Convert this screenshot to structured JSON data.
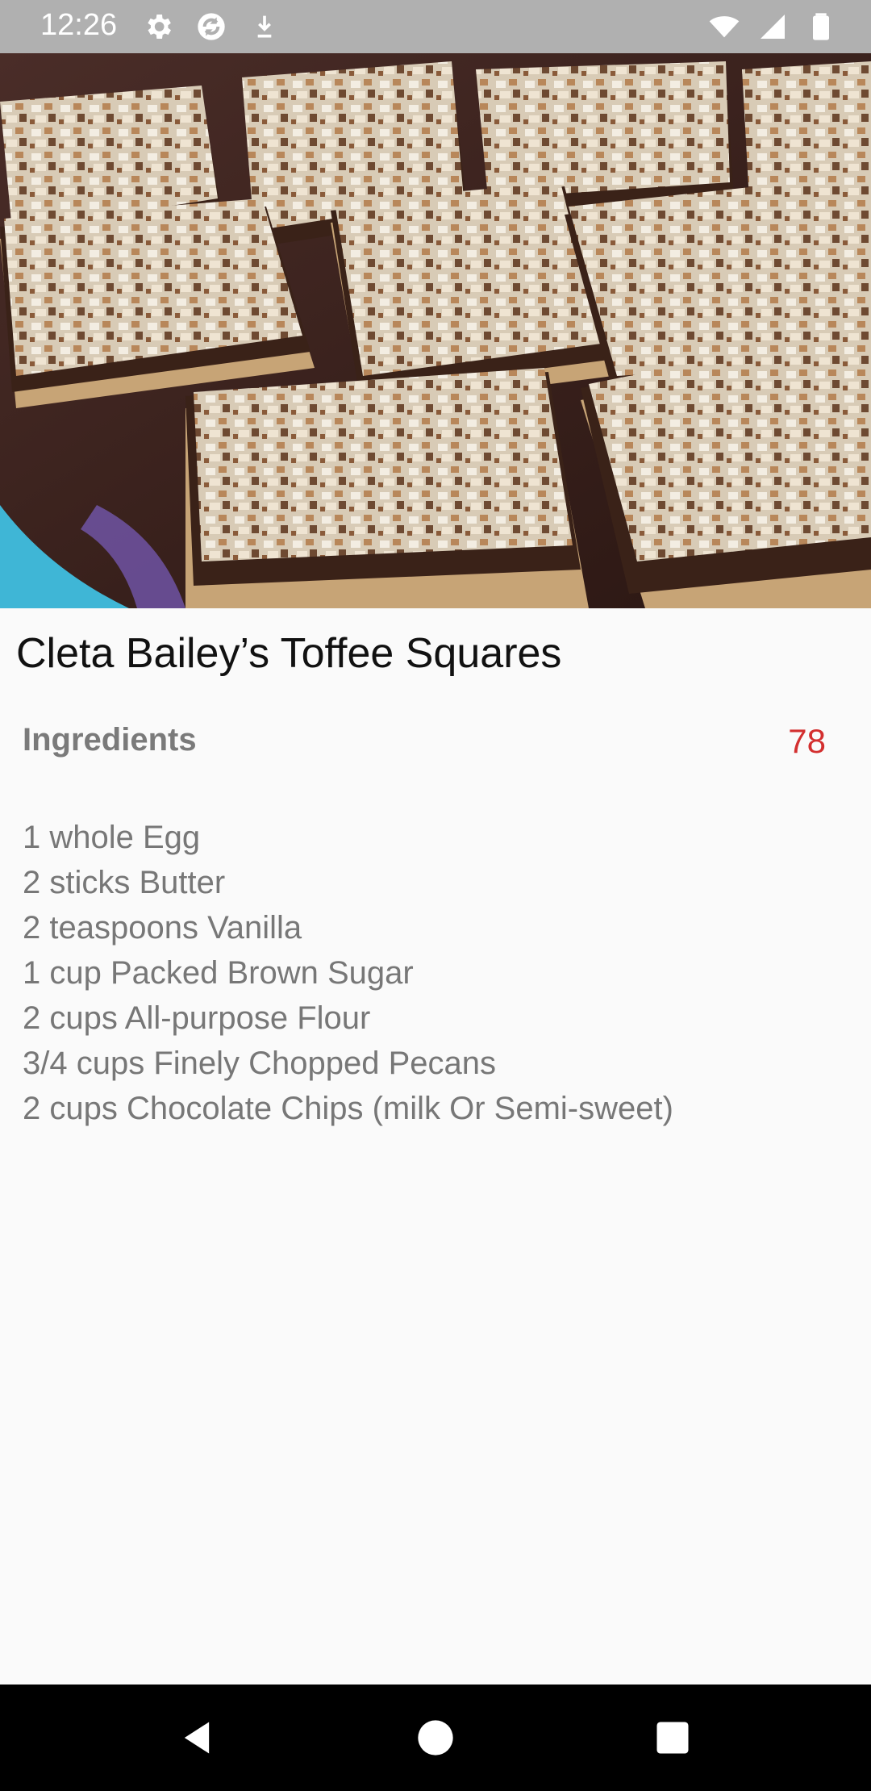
{
  "status_bar": {
    "time": "12:26",
    "icons_left": [
      "gear-icon",
      "sync-icon",
      "download-icon"
    ],
    "icons_right": [
      "wifi-icon",
      "signal-icon",
      "battery-icon"
    ]
  },
  "recipe": {
    "title": "Cleta Bailey’s Toffee Squares",
    "image": "toffee-squares-photo",
    "section_label": "Ingredients",
    "count": "78",
    "ingredients": [
      "1 whole Egg",
      "2 sticks Butter",
      "2 teaspoons Vanilla",
      "1 cup Packed Brown Sugar",
      "2 cups All-purpose Flour",
      "3/4 cups Finely Chopped Pecans",
      "2 cups Chocolate Chips (milk Or Semi-sweet)"
    ]
  },
  "colors": {
    "status_bar_bg": "#b0b0b0",
    "count_color": "#d32f2f",
    "label_color": "#7a7a7a",
    "nav_bar_bg": "#000000"
  },
  "nav_bar": {
    "buttons": [
      "back-icon",
      "home-icon",
      "recents-icon"
    ]
  }
}
